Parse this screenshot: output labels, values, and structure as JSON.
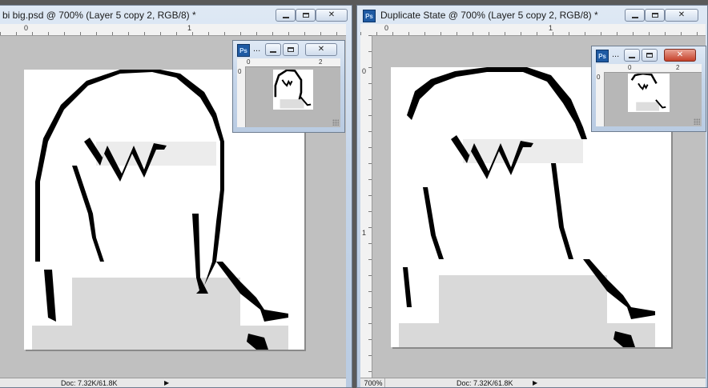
{
  "left_window": {
    "title": "bi big.psd @ 700% (Layer 5 copy 2, RGB/8) *",
    "ruler_h_ticks": [
      "0",
      "1"
    ],
    "status_doc": "Doc: 7.32K/61.8K"
  },
  "right_window": {
    "title": "Duplicate State @ 700% (Layer 5 copy 2, RGB/8) *",
    "ruler_h_ticks": [
      "0",
      "1"
    ],
    "ruler_v_ticks": [
      "0",
      "1"
    ],
    "status_zoom": "700%",
    "status_doc": "Doc: 7.32K/61.8K"
  },
  "left_navigator": {
    "title": "...",
    "ruler_h_ticks": [
      "0",
      "2"
    ],
    "ruler_v_ticks": [
      "0"
    ]
  },
  "right_navigator": {
    "title": "...",
    "ruler_h_ticks": [
      "0",
      "2"
    ],
    "ruler_v_ticks": [
      "0"
    ]
  },
  "icons": {
    "app": "photoshop-icon",
    "minimize": "minimize-icon",
    "maximize": "maximize-icon",
    "close": "close-icon"
  },
  "app_icon_text": "Ps",
  "colors": {
    "titlebar": "#c6d6ea",
    "close_active": "#c5412a",
    "canvas_bg": "#c0c0c0",
    "pixel_dark": "#000000",
    "pixel_light": "#e0e0e0"
  }
}
